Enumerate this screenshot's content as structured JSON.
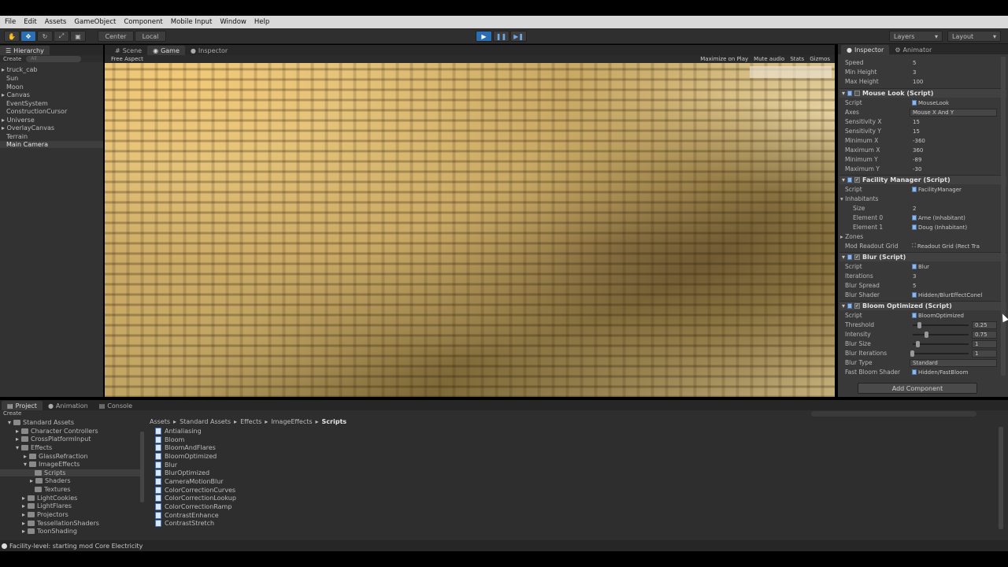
{
  "menu": [
    "File",
    "Edit",
    "Assets",
    "GameObject",
    "Component",
    "Mobile Input",
    "Window",
    "Help"
  ],
  "toolbar": {
    "center": "Center",
    "local": "Local",
    "layers": "Layers",
    "layout": "Layout"
  },
  "hierarchy": {
    "tab": "Hierarchy",
    "create": "Create",
    "search": "All",
    "items": [
      "truck_cab",
      "Sun",
      "Moon",
      "Canvas",
      "EventSystem",
      "ConstructionCursor",
      "Universe",
      "OverlayCanvas",
      "Terrain",
      "Main Camera"
    ]
  },
  "center_tabs": [
    "Scene",
    "Game",
    "Inspector"
  ],
  "game": {
    "aspect": "Free Aspect",
    "opts": [
      "Maximize on Play",
      "Mute audio",
      "Stats",
      "Gizmos"
    ]
  },
  "inspector": {
    "tabs": [
      "Inspector",
      "Animator"
    ],
    "top": [
      {
        "l": "Speed",
        "v": "5"
      },
      {
        "l": "Min Height",
        "v": "3"
      },
      {
        "l": "Max Height",
        "v": "100"
      }
    ],
    "mouse": {
      "title": "Mouse Look (Script)",
      "script": "MouseLook",
      "axes": "Mouse X And Y",
      "rows": [
        {
          "l": "Sensitivity X",
          "v": "15"
        },
        {
          "l": "Sensitivity Y",
          "v": "15"
        },
        {
          "l": "Minimum X",
          "v": "-360"
        },
        {
          "l": "Maximum X",
          "v": "360"
        },
        {
          "l": "Minimum Y",
          "v": "-89"
        },
        {
          "l": "Maximum Y",
          "v": "-30"
        }
      ]
    },
    "facility": {
      "title": "Facility Manager (Script)",
      "script": "FacilityManager",
      "inhabitants": "Inhabitants",
      "size": "2",
      "e0l": "Element 0",
      "e0": "Arne (Inhabitant)",
      "e1l": "Element 1",
      "e1": "Doug (Inhabitant)",
      "zones": "Zones",
      "gridl": "Mod Readout Grid",
      "grid": "Readout Grid (Rect Tra"
    },
    "blur": {
      "title": "Blur (Script)",
      "script": "Blur",
      "iter": "3",
      "spread": "5",
      "shader": "Hidden/BlurEffectConel"
    },
    "bloom": {
      "title": "Bloom Optimized (Script)",
      "script": "BloomOptimized",
      "threshold": "0.25",
      "intensity": "0.75",
      "blursize": "1",
      "bluriter": "1",
      "blurtype": "Standard",
      "shader": "Hidden/FastBloom"
    },
    "labels": {
      "script": "Script",
      "axes": "Axes",
      "size": "Size",
      "iterations": "Iterations",
      "blurspread": "Blur Spread",
      "blurshader": "Blur Shader",
      "threshold": "Threshold",
      "intensity": "Intensity",
      "blursize": "Blur Size",
      "bluriter": "Blur Iterations",
      "blurtype": "Blur Type",
      "fastshader": "Fast Bloom Shader"
    },
    "add": "Add Component"
  },
  "project": {
    "tabs": [
      "Project",
      "Animation",
      "Console"
    ],
    "create": "Create",
    "tree": [
      "Standard Assets",
      "Character Controllers",
      "CrossPlatformInput",
      "Effects",
      "GlassRefraction",
      "ImageEffects",
      "Scripts",
      "Shaders",
      "Textures",
      "LightCookies",
      "LightFlares",
      "Projectors",
      "TessellationShaders",
      "ToonShading"
    ],
    "crumbs": [
      "Assets",
      "Standard Assets",
      "Effects",
      "ImageEffects",
      "Scripts"
    ],
    "files": [
      "Antialiasing",
      "Bloom",
      "BloomAndFlares",
      "BloomOptimized",
      "Blur",
      "BlurOptimized",
      "CameraMotionBlur",
      "ColorCorrectionCurves",
      "ColorCorrectionLookup",
      "ColorCorrectionRamp",
      "ContrastEnhance",
      "ContrastStretch"
    ]
  },
  "status": "Facility-level: starting mod Core Electricity"
}
